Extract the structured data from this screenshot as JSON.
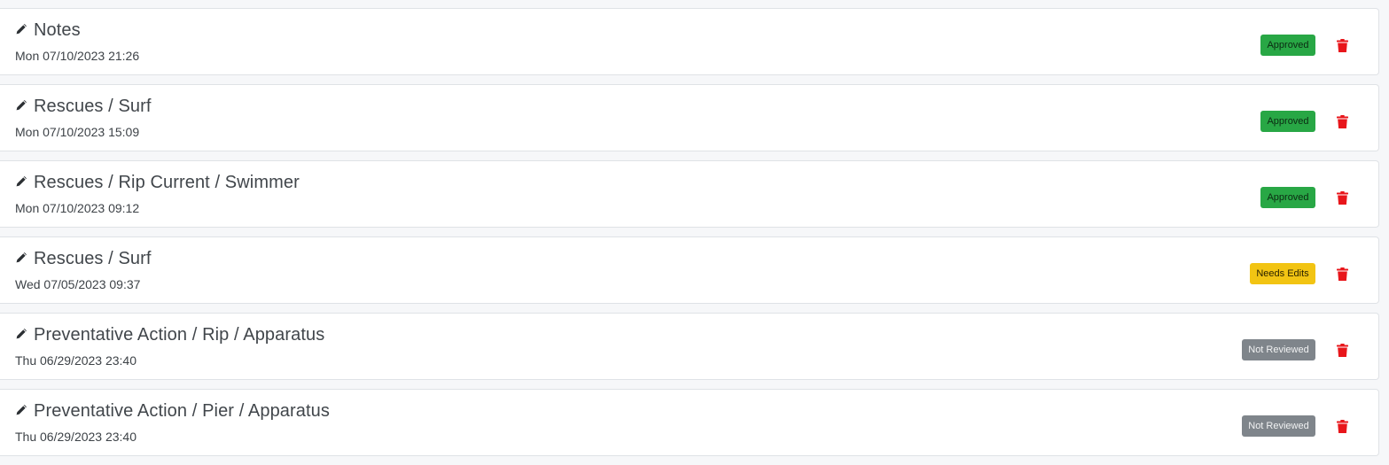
{
  "colors": {
    "approved": "#28a745",
    "needs_edits": "#f2c413",
    "not_reviewed": "#7f858b",
    "delete": "#e8161b"
  },
  "entries": [
    {
      "title": "Notes",
      "date": "Mon 07/10/2023 21:26",
      "status": "Approved",
      "status_type": "approved",
      "edit_icon": "pencil-icon",
      "delete_icon": "trash-icon"
    },
    {
      "title": "Rescues / Surf",
      "date": "Mon 07/10/2023 15:09",
      "status": "Approved",
      "status_type": "approved",
      "edit_icon": "pencil-icon",
      "delete_icon": "trash-icon"
    },
    {
      "title": "Rescues / Rip Current / Swimmer",
      "date": "Mon 07/10/2023 09:12",
      "status": "Approved",
      "status_type": "approved",
      "edit_icon": "pencil-icon",
      "delete_icon": "trash-icon"
    },
    {
      "title": "Rescues / Surf",
      "date": "Wed 07/05/2023 09:37",
      "status": "Needs Edits",
      "status_type": "needs",
      "edit_icon": "pencil-icon",
      "delete_icon": "trash-icon"
    },
    {
      "title": "Preventative Action / Rip / Apparatus",
      "date": "Thu 06/29/2023 23:40",
      "status": "Not Reviewed",
      "status_type": "notrev",
      "edit_icon": "pencil-icon",
      "delete_icon": "trash-icon"
    },
    {
      "title": "Preventative Action / Pier / Apparatus",
      "date": "Thu 06/29/2023 23:40",
      "status": "Not Reviewed",
      "status_type": "notrev",
      "edit_icon": "pencil-icon",
      "delete_icon": "trash-icon"
    }
  ]
}
